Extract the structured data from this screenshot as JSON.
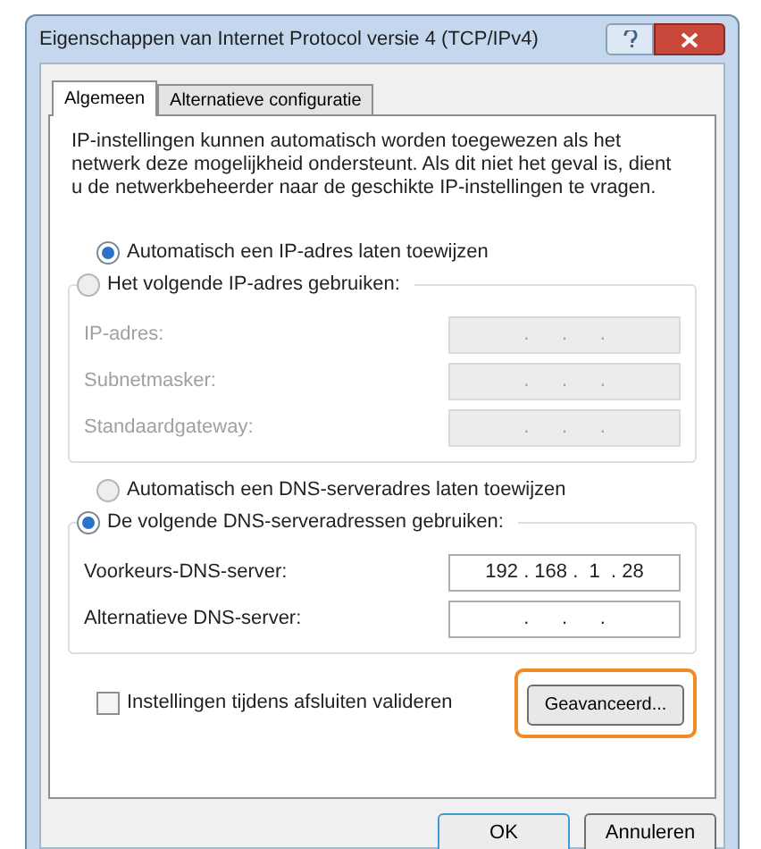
{
  "window": {
    "title": "Eigenschappen van Internet Protocol versie 4 (TCP/IPv4)"
  },
  "tabs": [
    {
      "label": "Algemeen",
      "selected": true
    },
    {
      "label": "Alternatieve configuratie",
      "selected": false
    }
  ],
  "description": "IP-instellingen kunnen automatisch worden toegewezen als het netwerk deze mogelijkheid ondersteunt. Als dit niet het geval is, dient u de netwerkbeheerder naar de geschikte IP-instellingen te vragen.",
  "ip_auto": {
    "label": "Automatisch een IP-adres laten toewijzen",
    "selected": true
  },
  "ip_manual": {
    "label": "Het volgende IP-adres gebruiken:",
    "selected": false,
    "disabled": true,
    "fields": [
      {
        "label": "IP-adres:",
        "value": ".      .      ."
      },
      {
        "label": "Subnetmasker:",
        "value": ".      .      ."
      },
      {
        "label": "Standaardgateway:",
        "value": ".      .      ."
      }
    ]
  },
  "dns_auto": {
    "label": "Automatisch een DNS-serveradres laten toewijzen",
    "selected": false
  },
  "dns_manual": {
    "label": "De volgende DNS-serveradressen gebruiken:",
    "selected": true,
    "disabled": false,
    "fields": [
      {
        "label": "Voorkeurs-DNS-server:",
        "value": "192 . 168 .  1  . 28"
      },
      {
        "label": "Alternatieve DNS-server:",
        "value": ".      .      ."
      }
    ]
  },
  "validate": {
    "label": "Instellingen tijdens afsluiten valideren",
    "checked": false
  },
  "advanced_button": {
    "label": "Geavanceerd...",
    "highlighted": true
  },
  "buttons": [
    {
      "label": "OK",
      "default": true
    },
    {
      "label": "Annuleren",
      "default": false
    }
  ]
}
